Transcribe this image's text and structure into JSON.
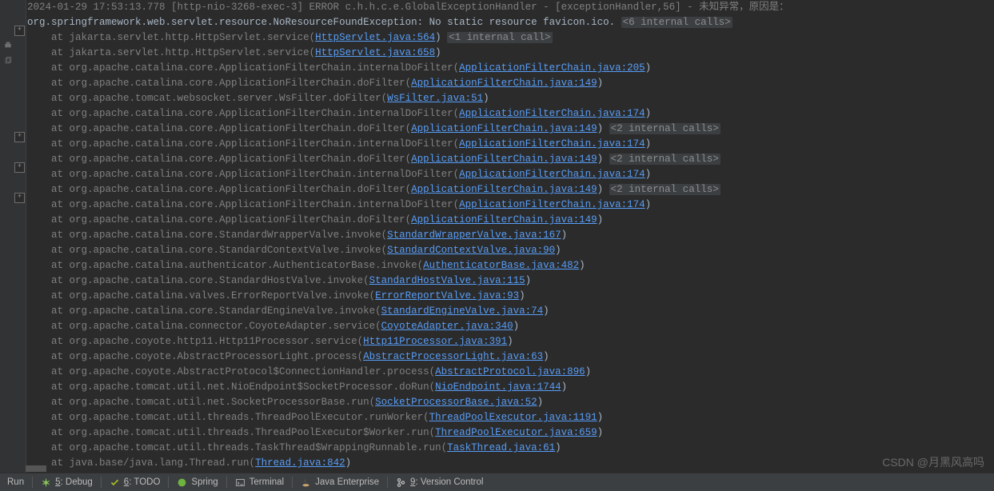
{
  "log": {
    "top1": "2024-01-29 17:53:13.778 [http-nio-3268-exec-3] ERROR c.h.h.c.e.GlobalExceptionHandler - [exceptionHandler,56] - 未知异常，原因是：",
    "exception": "org.springframework.web.servlet.resource.NoResourceFoundException: No static resource favicon.ico.",
    "fold6": "<6 internal calls>",
    "fold1": "<1 internal call>",
    "fold2a": "<2 internal calls>",
    "fold2b": "<2 internal calls>",
    "fold2c": "<2 internal calls>",
    "lines": [
      {
        "pre": "at jakarta.servlet.http.HttpServlet.service(",
        "link": "HttpServlet.java:564",
        "suf": ")",
        "fold": "fold1"
      },
      {
        "pre": "at jakarta.servlet.http.HttpServlet.service(",
        "link": "HttpServlet.java:658",
        "suf": ")"
      },
      {
        "pre": "at org.apache.catalina.core.ApplicationFilterChain.internalDoFilter(",
        "link": "ApplicationFilterChain.java:205",
        "suf": ")"
      },
      {
        "pre": "at org.apache.catalina.core.ApplicationFilterChain.doFilter(",
        "link": "ApplicationFilterChain.java:149",
        "suf": ")"
      },
      {
        "pre": "at org.apache.tomcat.websocket.server.WsFilter.doFilter(",
        "link": "WsFilter.java:51",
        "suf": ")"
      },
      {
        "pre": "at org.apache.catalina.core.ApplicationFilterChain.internalDoFilter(",
        "link": "ApplicationFilterChain.java:174",
        "suf": ")"
      },
      {
        "pre": "at org.apache.catalina.core.ApplicationFilterChain.doFilter(",
        "link": "ApplicationFilterChain.java:149",
        "suf": ")",
        "fold": "fold2a"
      },
      {
        "pre": "at org.apache.catalina.core.ApplicationFilterChain.internalDoFilter(",
        "link": "ApplicationFilterChain.java:174",
        "suf": ")"
      },
      {
        "pre": "at org.apache.catalina.core.ApplicationFilterChain.doFilter(",
        "link": "ApplicationFilterChain.java:149",
        "suf": ")",
        "fold": "fold2b"
      },
      {
        "pre": "at org.apache.catalina.core.ApplicationFilterChain.internalDoFilter(",
        "link": "ApplicationFilterChain.java:174",
        "suf": ")"
      },
      {
        "pre": "at org.apache.catalina.core.ApplicationFilterChain.doFilter(",
        "link": "ApplicationFilterChain.java:149",
        "suf": ")",
        "fold": "fold2c"
      },
      {
        "pre": "at org.apache.catalina.core.ApplicationFilterChain.internalDoFilter(",
        "link": "ApplicationFilterChain.java:174",
        "suf": ")"
      },
      {
        "pre": "at org.apache.catalina.core.ApplicationFilterChain.doFilter(",
        "link": "ApplicationFilterChain.java:149",
        "suf": ")"
      },
      {
        "pre": "at org.apache.catalina.core.StandardWrapperValve.invoke(",
        "link": "StandardWrapperValve.java:167",
        "suf": ")"
      },
      {
        "pre": "at org.apache.catalina.core.StandardContextValve.invoke(",
        "link": "StandardContextValve.java:90",
        "suf": ")"
      },
      {
        "pre": "at org.apache.catalina.authenticator.AuthenticatorBase.invoke(",
        "link": "AuthenticatorBase.java:482",
        "suf": ")"
      },
      {
        "pre": "at org.apache.catalina.core.StandardHostValve.invoke(",
        "link": "StandardHostValve.java:115",
        "suf": ")"
      },
      {
        "pre": "at org.apache.catalina.valves.ErrorReportValve.invoke(",
        "link": "ErrorReportValve.java:93",
        "suf": ")"
      },
      {
        "pre": "at org.apache.catalina.core.StandardEngineValve.invoke(",
        "link": "StandardEngineValve.java:74",
        "suf": ")"
      },
      {
        "pre": "at org.apache.catalina.connector.CoyoteAdapter.service(",
        "link": "CoyoteAdapter.java:340",
        "suf": ")"
      },
      {
        "pre": "at org.apache.coyote.http11.Http11Processor.service(",
        "link": "Http11Processor.java:391",
        "suf": ")"
      },
      {
        "pre": "at org.apache.coyote.AbstractProcessorLight.process(",
        "link": "AbstractProcessorLight.java:63",
        "suf": ")"
      },
      {
        "pre": "at org.apache.coyote.AbstractProtocol$ConnectionHandler.process(",
        "link": "AbstractProtocol.java:896",
        "suf": ")"
      },
      {
        "pre": "at org.apache.tomcat.util.net.NioEndpoint$SocketProcessor.doRun(",
        "link": "NioEndpoint.java:1744",
        "suf": ")"
      },
      {
        "pre": "at org.apache.tomcat.util.net.SocketProcessorBase.run(",
        "link": "SocketProcessorBase.java:52",
        "suf": ")"
      },
      {
        "pre": "at org.apache.tomcat.util.threads.ThreadPoolExecutor.runWorker(",
        "link": "ThreadPoolExecutor.java:1191",
        "suf": ")"
      },
      {
        "pre": "at org.apache.tomcat.util.threads.ThreadPoolExecutor$Worker.run(",
        "link": "ThreadPoolExecutor.java:659",
        "suf": ")"
      },
      {
        "pre": "at org.apache.tomcat.util.threads.TaskThread$WrappingRunnable.run(",
        "link": "TaskThread.java:61",
        "suf": ")"
      },
      {
        "pre": "at java.base/java.lang.Thread.run(",
        "link": "Thread.java:842",
        "suf": ")"
      }
    ]
  },
  "status": {
    "run": "Run",
    "debug_u": "5",
    "debug": ": Debug",
    "todo_u": "6",
    "todo": ": TODO",
    "spring": "Spring",
    "terminal": "Terminal",
    "je": "Java Enterprise",
    "vc_u": "9",
    "vc": ": Version Control"
  },
  "watermark": "CSDN @月黑风高吗"
}
